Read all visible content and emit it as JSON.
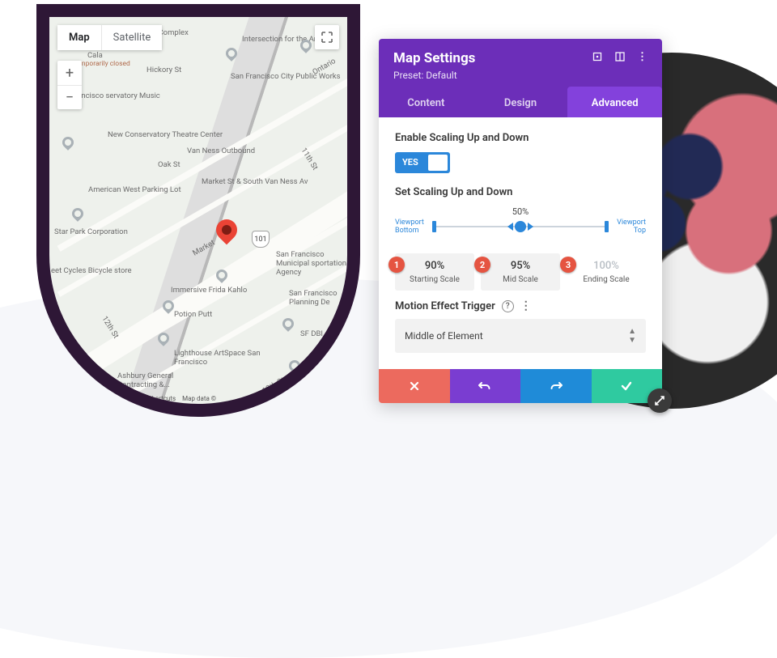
{
  "map": {
    "view_modes": {
      "map": "Map",
      "satellite": "Satellite"
    },
    "zoom_in": "+",
    "zoom_out": "−",
    "attribution": {
      "shortcuts": "Keyboard shortcuts",
      "mapdata": "Map data ©"
    },
    "route_101": "101",
    "labels": {
      "cfc": "Center for Complex",
      "ifa": "Intersection for the Arts",
      "cala": "Cala",
      "cala_sub": "Temporarily closed",
      "hickory": "Hickory St",
      "sfpw": "San Francisco City Public Works",
      "fcm": "Francisco servatory Music",
      "nctc": "New Conservatory Theatre Center",
      "vno": "Van Ness Outbound",
      "oak": "Oak St",
      "mssv": "Market St & South Van Ness Av",
      "awpl": "American West Parking Lot",
      "spc": "Star Park Corporation",
      "sfmta": "San Francisco Municipal sportation Agency",
      "market": "Market",
      "eetc": "eet Cycles Bicycle store",
      "ifk": "Immersive Frida Kahlo",
      "sfp": "San Francisco Planning De",
      "pp": "Potion Putt",
      "sfdbi": "SF DBI",
      "lasf": "Lighthouse ArtSpace San Francisco",
      "agc": "Ashbury General Contracting &...",
      "blue": "Blue B",
      "t11": "11th St",
      "t12a": "12th St",
      "t12b": "12th St",
      "ontario": "Ontario"
    }
  },
  "panel": {
    "title": "Map Settings",
    "preset": "Preset: Default",
    "tabs": {
      "content": "Content",
      "design": "Design",
      "advanced": "Advanced"
    },
    "enable_label": "Enable Scaling Up and Down",
    "toggle_yes": "YES",
    "set_label": "Set Scaling Up and Down",
    "slider": {
      "pct": "50%",
      "left": "Viewport Bottom",
      "right": "Viewport Top"
    },
    "scales": {
      "b1": "1",
      "v1": "90%",
      "l1": "Starting Scale",
      "b2": "2",
      "v2": "95%",
      "l2": "Mid Scale",
      "b3": "3",
      "v3": "100%",
      "l3": "Ending Scale"
    },
    "trigger_label": "Motion Effect Trigger",
    "trigger_value": "Middle of Element"
  }
}
